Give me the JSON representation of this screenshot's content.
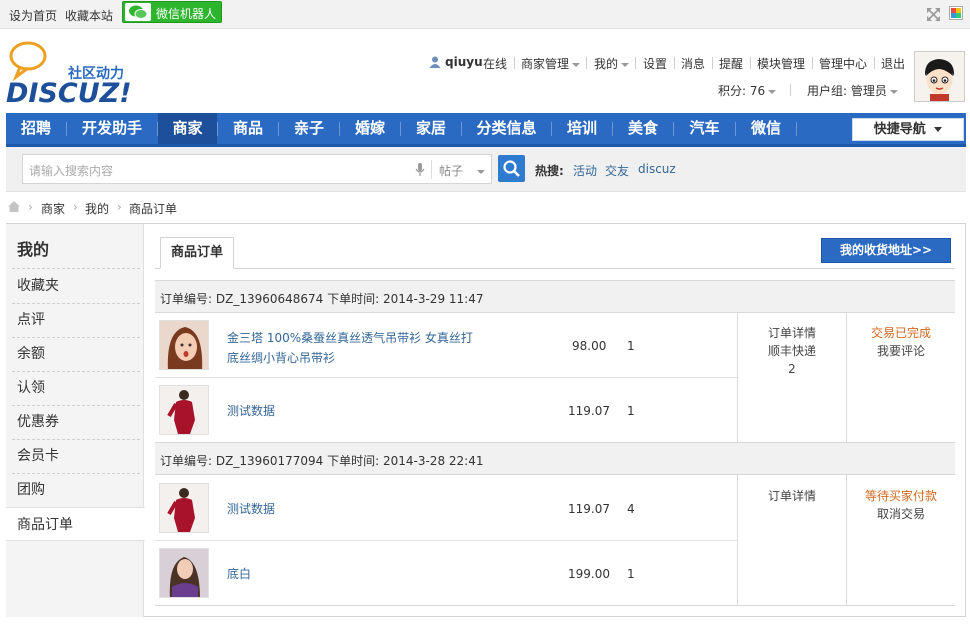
{
  "topbar": {
    "set_home": "设为首页",
    "bookmark": "收藏本站",
    "wechat_robot": "微信机器人",
    "icons": [
      "expand-icon",
      "color-scheme-icon"
    ]
  },
  "logo": {
    "tagline": "社区动力",
    "brand": "DISCUZ!"
  },
  "user": {
    "name": "qiuyu",
    "status": "在线",
    "menu": [
      "商家管理",
      "我的",
      "设置",
      "消息",
      "提醒",
      "模块管理",
      "管理中心",
      "退出"
    ],
    "points": "积分: 76",
    "group": "用户组: 管理员"
  },
  "nav": {
    "items": [
      "招聘",
      "开发助手",
      "商家",
      "商品",
      "亲子",
      "婚嫁",
      "家居",
      "分类信息",
      "培训",
      "美食",
      "汽车",
      "微信"
    ],
    "active": "商家",
    "quick_nav": "快捷导航"
  },
  "search": {
    "placeholder": "请输入搜索内容",
    "scope": "帖子",
    "hot_label": "热搜:",
    "hot_terms": [
      "活动",
      "交友",
      "discuz"
    ]
  },
  "breadcrumb": [
    "商家",
    "我的",
    "商品订单"
  ],
  "sidebar": {
    "title": "我的",
    "items": [
      "收藏夹",
      "点评",
      "余额",
      "认领",
      "优惠券",
      "会员卡",
      "团购",
      "商品订单"
    ],
    "active": "商品订单"
  },
  "content": {
    "tab": "商品订单",
    "address_button": "我的收货地址>>",
    "orders": [
      {
        "header": "订单编号: DZ_13960648674 下单时间: 2014-3-29 11:47",
        "items": [
          {
            "name_line1": "金三塔 100%桑蚕丝真丝透气吊带衫 女真丝打",
            "name_line2": "底丝绸小背心吊带衫",
            "price": "98.00",
            "qty": "1"
          },
          {
            "name_line1": "测试数据",
            "price": "119.07",
            "qty": "1"
          }
        ],
        "detail": "订单详情",
        "shipping": "顺丰快递",
        "shipping_no": "2",
        "status": "交易已完成",
        "action": "我要评论"
      },
      {
        "header": "订单编号: DZ_13960177094 下单时间: 2014-3-28 22:41",
        "items": [
          {
            "name_line1": "测试数据",
            "price": "119.07",
            "qty": "4"
          },
          {
            "name_line1": "底白",
            "price": "199.00",
            "qty": "1"
          }
        ],
        "detail": "订单详情",
        "status": "等待买家付款",
        "action": "取消交易"
      }
    ]
  },
  "colors": {
    "nav_blue": "#2b6ac2",
    "nav_active": "#1d4f9a",
    "wechat_green": "#2db52d",
    "status_orange": "#d2691e",
    "link_blue": "#336699"
  }
}
